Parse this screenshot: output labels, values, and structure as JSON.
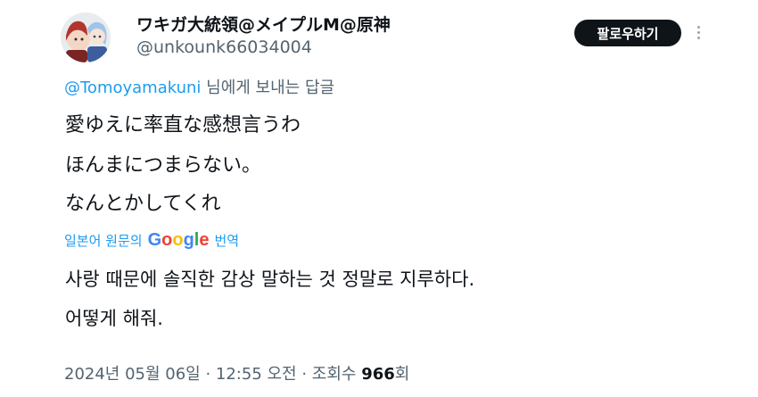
{
  "author": {
    "display_name": "ワキガ大統領@メイプルM@原神",
    "handle": "@unkounk66034004"
  },
  "follow_button_label": "팔로우하기",
  "reply_context": {
    "mention": "@Tomoyamakuni",
    "suffix": " 님에게 보내는 답글"
  },
  "tweet_lines": [
    "愛ゆえに率直な感想言うわ",
    "ほんまにつまらない。",
    "なんとかしてくれ"
  ],
  "translation": {
    "prefix": "일본어 원문의",
    "provider": "Google",
    "suffix": "번역",
    "lines": [
      "사랑 때문에 솔직한 감상 말하는 것 정말로 지루하다.",
      "어떻게 해줘."
    ]
  },
  "meta": {
    "timestamp": "2024년 05월 06일 · 12:55 오전 · 조회수 ",
    "views": "966",
    "views_suffix": "회"
  },
  "google_colors": [
    "#4285F4",
    "#EA4335",
    "#FBBC05",
    "#4285F4",
    "#34A853",
    "#EA4335"
  ]
}
